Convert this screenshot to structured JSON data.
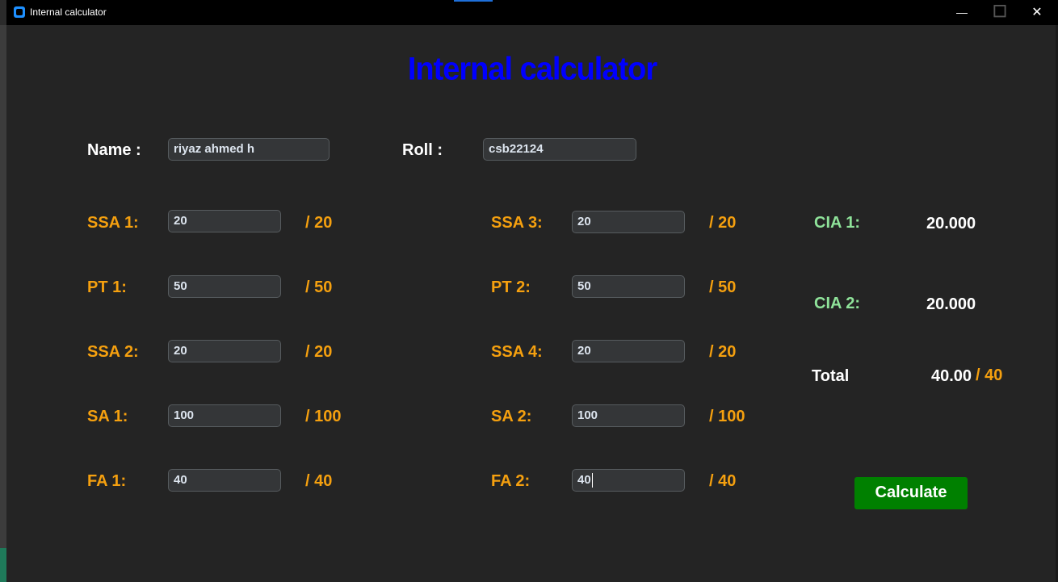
{
  "window": {
    "title": "Internal calculator",
    "min_glyph": "—",
    "max_glyph": "☐",
    "close_glyph": "✕"
  },
  "heading": "Internal calculator",
  "student": {
    "name_label": "Name :",
    "name_value": "riyaz ahmed h",
    "roll_label": "Roll :",
    "roll_value": "csb22124"
  },
  "left_fields": [
    {
      "label": "SSA 1:",
      "value": "20",
      "max": "/ 20"
    },
    {
      "label": "PT 1:",
      "value": "50",
      "max": "/ 50"
    },
    {
      "label": "SSA 2:",
      "value": "20",
      "max": "/ 20"
    },
    {
      "label": "SA 1:",
      "value": "100",
      "max": "/ 100"
    },
    {
      "label": "FA 1:",
      "value": "40",
      "max": "/ 40"
    }
  ],
  "right_fields": [
    {
      "label": "SSA 3:",
      "value": "20",
      "max": "/ 20"
    },
    {
      "label": "PT 2:",
      "value": "50",
      "max": "/ 50"
    },
    {
      "label": "SSA 4:",
      "value": "20",
      "max": "/ 20"
    },
    {
      "label": "SA 2:",
      "value": "100",
      "max": "/ 100"
    },
    {
      "label": "FA 2:",
      "value": "40",
      "max": "/ 40"
    }
  ],
  "results": {
    "cia1_label": "CIA 1:",
    "cia1_value": "20.000",
    "cia2_label": "CIA 2:",
    "cia2_value": "20.000",
    "total_label": "Total",
    "total_value": "40.00",
    "total_max": "/ 40"
  },
  "calculate_label": "Calculate",
  "colors": {
    "heading": "#0000ff",
    "field_label": "#f5a00f",
    "cia_label": "#8fe39a",
    "button": "#008000"
  }
}
